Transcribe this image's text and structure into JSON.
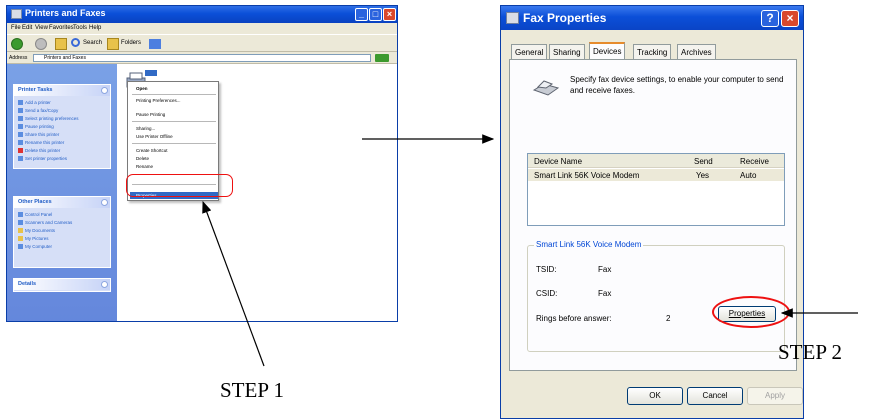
{
  "step1": "STEP 1",
  "step2": "STEP 2",
  "printers_window": {
    "title": "Printers and Faxes",
    "menu": [
      "File",
      "Edit",
      "View",
      "Favorites",
      "Tools",
      "Help"
    ],
    "toolbar": {
      "search": "Search",
      "folders": "Folders"
    },
    "address_label": "Address",
    "address_value": "Printers and Faxes",
    "printer_tasks": {
      "title": "Printer Tasks",
      "items": [
        "Add a printer",
        "Send a fax/Copy",
        "Select printing preferences",
        "Pause printing",
        "Share this printer",
        "Rename this printer",
        "Delete this printer",
        "Set printer properties"
      ]
    },
    "other_places": {
      "title": "Other Places",
      "items": [
        "Control Panel",
        "Scanners and Cameras",
        "My Documents",
        "My Pictures",
        "My Computer"
      ]
    },
    "details_title": "Details",
    "context_menu": [
      "Open",
      "Printing Preferences...",
      "Pause Printing",
      "Sharing...",
      "Use Printer Offline",
      "Create Shortcut",
      "Delete",
      "Rename",
      "Properties"
    ]
  },
  "fax_window": {
    "title": "Fax Properties",
    "tabs": [
      "General",
      "Sharing",
      "Devices",
      "Tracking",
      "Archives"
    ],
    "description": "Specify fax device settings, to enable your computer to send and receive faxes.",
    "columns": [
      "Device Name",
      "Send",
      "Receive"
    ],
    "device": {
      "name": "Smart Link 56K Voice Modem",
      "send": "Yes",
      "receive": "Auto"
    },
    "group_title": "Smart Link 56K Voice Modem",
    "tsid_label": "TSID:",
    "tsid_value": "Fax",
    "csid_label": "CSID:",
    "csid_value": "Fax",
    "rings_label": "Rings before answer:",
    "rings_value": "2",
    "properties_button": "Properties",
    "ok": "OK",
    "cancel": "Cancel",
    "apply": "Apply"
  }
}
